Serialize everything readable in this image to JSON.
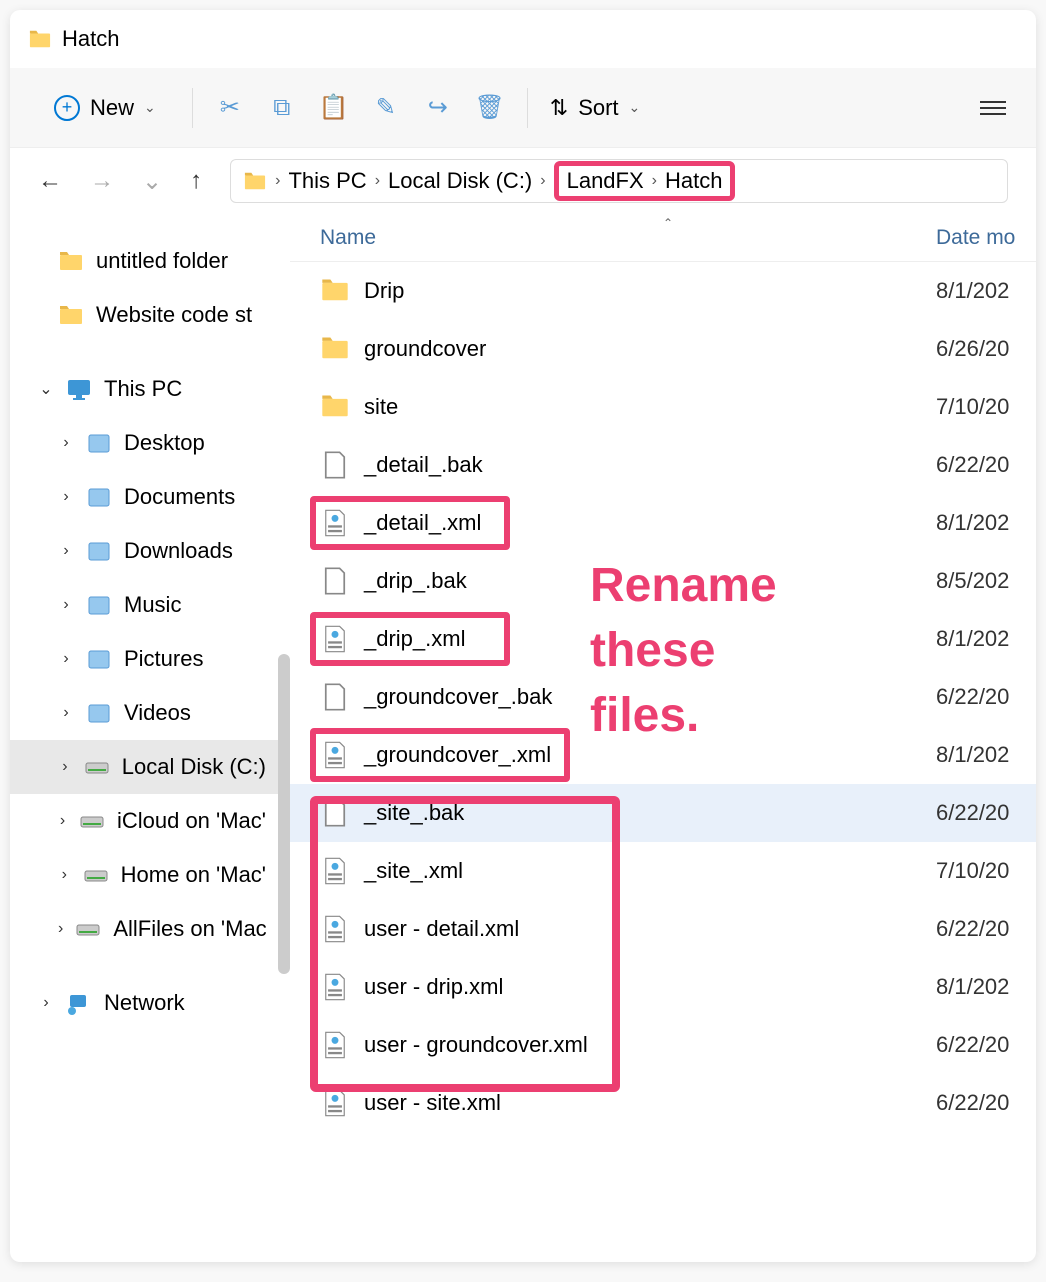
{
  "title": "Hatch",
  "toolbar": {
    "new_label": "New",
    "sort_label": "Sort"
  },
  "breadcrumb": {
    "items": [
      "This PC",
      "Local Disk (C:)",
      "LandFX",
      "Hatch"
    ]
  },
  "sidebar": {
    "quick": [
      {
        "label": "untitled folder",
        "icon": "folder"
      },
      {
        "label": "Website code st",
        "icon": "folder"
      }
    ],
    "thispc_label": "This PC",
    "thispc_items": [
      {
        "label": "Desktop",
        "icon": "lib"
      },
      {
        "label": "Documents",
        "icon": "lib"
      },
      {
        "label": "Downloads",
        "icon": "lib"
      },
      {
        "label": "Music",
        "icon": "lib"
      },
      {
        "label": "Pictures",
        "icon": "lib"
      },
      {
        "label": "Videos",
        "icon": "lib"
      },
      {
        "label": "Local Disk (C:)",
        "icon": "drive",
        "selected": true
      },
      {
        "label": "iCloud on 'Mac'",
        "icon": "drive"
      },
      {
        "label": "Home on 'Mac'",
        "icon": "drive"
      },
      {
        "label": "AllFiles on 'Mac",
        "icon": "drive"
      }
    ],
    "network_label": "Network"
  },
  "columns": {
    "name": "Name",
    "date": "Date mo"
  },
  "files": [
    {
      "name": "Drip",
      "date": "8/1/202",
      "icon": "folder"
    },
    {
      "name": "groundcover",
      "date": "6/26/20",
      "icon": "folder"
    },
    {
      "name": "site",
      "date": "7/10/20",
      "icon": "folder"
    },
    {
      "name": "_detail_.bak",
      "date": "6/22/20",
      "icon": "file"
    },
    {
      "name": "_detail_.xml",
      "date": "8/1/202",
      "icon": "xml",
      "hl": "sm"
    },
    {
      "name": "_drip_.bak",
      "date": "8/5/202",
      "icon": "file"
    },
    {
      "name": "_drip_.xml",
      "date": "8/1/202",
      "icon": "xml",
      "hl": "sm"
    },
    {
      "name": "_groundcover_.bak",
      "date": "6/22/20",
      "icon": "file"
    },
    {
      "name": "_groundcover_.xml",
      "date": "8/1/202",
      "icon": "xml",
      "hl": "wide"
    },
    {
      "name": "_site_.bak",
      "date": "6/22/20",
      "icon": "file",
      "selected": true
    },
    {
      "name": "_site_.xml",
      "date": "7/10/20",
      "icon": "xml"
    },
    {
      "name": "user - detail.xml",
      "date": "6/22/20",
      "icon": "xml"
    },
    {
      "name": "user - drip.xml",
      "date": "8/1/202",
      "icon": "xml"
    },
    {
      "name": "user - groundcover.xml",
      "date": "6/22/20",
      "icon": "xml"
    },
    {
      "name": "user - site.xml",
      "date": "6/22/20",
      "icon": "xml"
    }
  ],
  "annotation": "Rename these files."
}
